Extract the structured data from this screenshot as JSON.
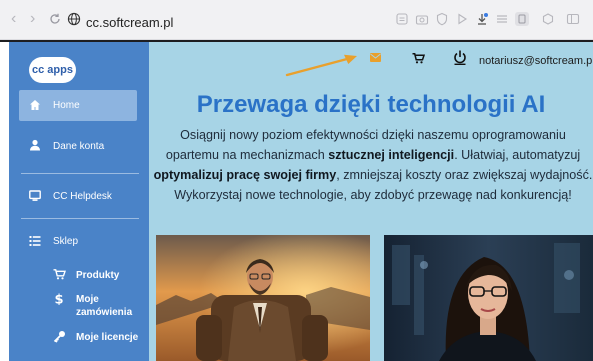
{
  "browser": {
    "address": "cc.softcream.pl",
    "back_icon": "chevron-left-icon",
    "forward_icon": "chevron-right-icon",
    "reload_icon": "reload-icon",
    "site_icon": "globe-icon"
  },
  "sidebar": {
    "logo": "cc apps",
    "items": [
      {
        "label": "Home",
        "icon": "home-icon",
        "active": true
      },
      {
        "label": "Dane konta",
        "icon": "user-icon",
        "active": false
      },
      {
        "label": "CC Helpdesk",
        "icon": "monitor-icon",
        "active": false
      },
      {
        "label": "Sklep",
        "icon": "list-icon",
        "active": false
      }
    ],
    "sub_items": [
      {
        "label": "Produkty",
        "icon": "cart-icon"
      },
      {
        "label": "Moje zamówienia",
        "icon": "dollar-icon"
      },
      {
        "label": "Moje licencje",
        "icon": "key-icon"
      }
    ]
  },
  "topbar": {
    "email": "notariusz@softcream.pl",
    "mail_icon": "mail-icon",
    "cart_icon": "cart-icon",
    "power_icon": "power-icon"
  },
  "main": {
    "headline": "Przewaga dzięki technologii AI",
    "para": {
      "s1": "Osiągnij nowy poziom efektywności dzięki naszemu oprogramowaniu opartemu na mechanizmach ",
      "b1": "sztucznej inteligencji",
      "s2": ". Ułatwiaj, automatyzuj ",
      "b2": "optymalizuj pracę swojej firmy",
      "s3": ", zmniejszaj koszty oraz zwiększaj wydajność. Wykorzystaj nowe technologie, aby zdobyć przewagę nad konkurencją!"
    }
  },
  "colors": {
    "sidebar": "#4a83c8",
    "sidebar_active": "#8db4e0",
    "main_bg": "#a7d4e6",
    "headline": "#2a72c7",
    "arrow": "#e9a02c"
  }
}
